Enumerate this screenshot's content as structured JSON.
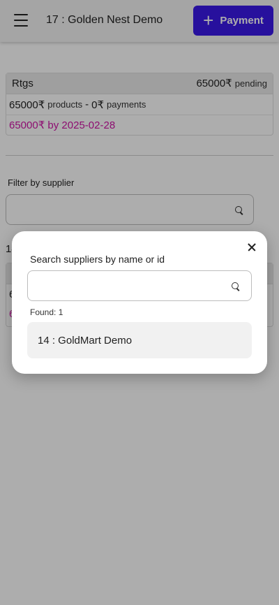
{
  "header": {
    "title": "17 : Golden Nest Demo",
    "payment_label": "Payment",
    "payment_color": "#3a18e8"
  },
  "card": {
    "type": "Rtgs",
    "amount": "65000₹",
    "status": "pending",
    "products_amount": "65000₹",
    "products_label": "products",
    "separator": "-",
    "payments_amount": "0₹",
    "payments_label": "payments",
    "due": "65000₹ by 2025-02-28",
    "due_color": "#d014a6"
  },
  "filter": {
    "label": "Filter by supplier",
    "placeholder": ""
  },
  "background_list": {
    "count_partial": "14",
    "row_partial": "6",
    "due_partial": "6"
  },
  "modal": {
    "title": "Search suppliers by name or id",
    "search_value": "",
    "found_text": "Found: 1",
    "results": [
      {
        "label": "14 : GoldMart Demo"
      }
    ]
  }
}
